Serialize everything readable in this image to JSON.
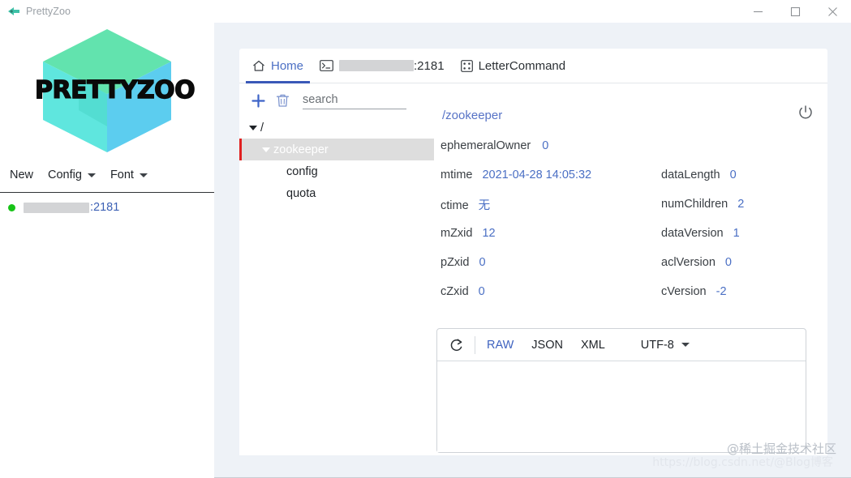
{
  "window": {
    "title": "PrettyZoo",
    "app_icon": "prettyzoo-logo-icon",
    "minimize_label": "—",
    "maximize_label": "□",
    "close_label": "✕"
  },
  "sidebar": {
    "logo_text": "PRETTYZOO",
    "logo_colors": {
      "top_face": "#62e3ae",
      "left_face": "#5fe6de",
      "right_face": "#5ccdef",
      "center_face": "#56d9d0"
    },
    "menu": [
      {
        "label": "New",
        "has_caret": false
      },
      {
        "label": "Config",
        "has_caret": true
      },
      {
        "label": "Font",
        "has_caret": true
      }
    ],
    "servers": [
      {
        "status": "online",
        "status_color": "#17c317",
        "host_redacted": true,
        "port_text": ":2181"
      }
    ]
  },
  "tabs": [
    {
      "label": "Home",
      "icon": "home-icon",
      "active": true,
      "redacted": false
    },
    {
      "label": "",
      "icon": "terminal-icon",
      "active": false,
      "redacted": true,
      "port_text": ":2181"
    },
    {
      "label": "LetterCommand",
      "icon": "dice-four-icon",
      "active": false,
      "redacted": false
    }
  ],
  "tree_toolbar": {
    "add_icon": "plus-icon",
    "delete_icon": "trash-icon",
    "search_value": "",
    "search_placeholder": "search"
  },
  "tree": [
    {
      "label": "/",
      "level": 0,
      "expanded": true,
      "has_toggle": true,
      "selected": false
    },
    {
      "label": "zookeeper",
      "level": 1,
      "expanded": true,
      "has_toggle": true,
      "selected": true
    },
    {
      "label": "config",
      "level": 2,
      "expanded": false,
      "has_toggle": false,
      "selected": false
    },
    {
      "label": "quota",
      "level": 2,
      "expanded": false,
      "has_toggle": false,
      "selected": false
    }
  ],
  "node_detail": {
    "path": "/zookeeper",
    "power_icon": "power-icon",
    "rows": [
      [
        {
          "key": "ephemeralOwner",
          "value": "0"
        }
      ],
      [
        {
          "key": "mtime",
          "value": "2021-04-28 14:05:32"
        },
        {
          "key": "dataLength",
          "value": "0"
        }
      ],
      [
        {
          "key": "ctime",
          "value": "无"
        },
        {
          "key": "numChildren",
          "value": "2"
        }
      ],
      [
        {
          "key": "mZxid",
          "value": "12"
        },
        {
          "key": "dataVersion",
          "value": "1"
        }
      ],
      [
        {
          "key": "pZxid",
          "value": "0"
        },
        {
          "key": "aclVersion",
          "value": "0"
        }
      ],
      [
        {
          "key": "cZxid",
          "value": "0"
        },
        {
          "key": "cVersion",
          "value": "-2"
        }
      ]
    ]
  },
  "editor": {
    "refresh_icon": "refresh-icon",
    "formats": [
      {
        "label": "RAW",
        "active": true
      },
      {
        "label": "JSON",
        "active": false
      },
      {
        "label": "XML",
        "active": false
      }
    ],
    "encoding": "UTF-8",
    "content": ""
  },
  "watermarks": {
    "main": "@稀土掘金技术社区",
    "url": "https://blog.csdn.net/@Blog博客"
  }
}
